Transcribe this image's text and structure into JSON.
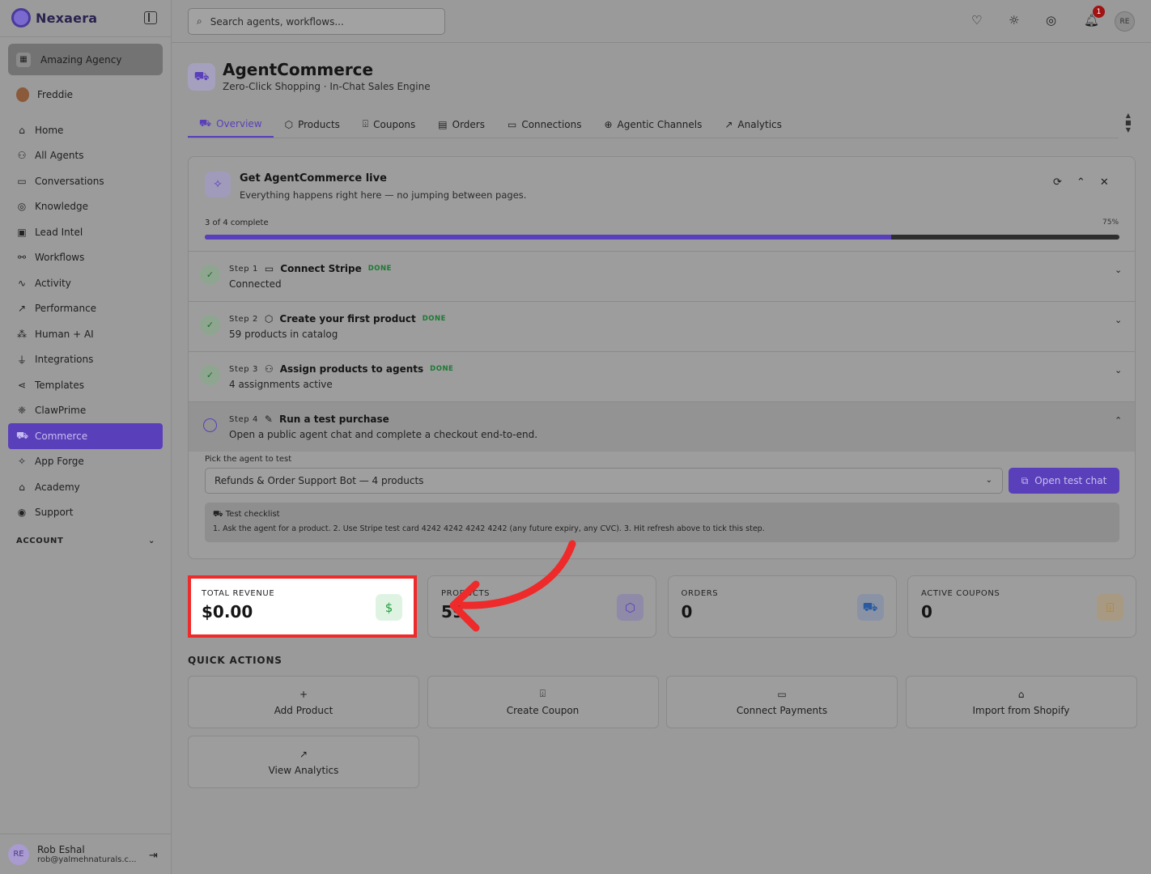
{
  "brand": {
    "name": "Nexaera"
  },
  "sidebar": {
    "agency": "Amazing Agency",
    "user": "Freddie",
    "items": [
      {
        "label": "Home",
        "icon": "home-icon",
        "glyph": "⌂"
      },
      {
        "label": "All Agents",
        "icon": "bot-icon",
        "glyph": "⚇"
      },
      {
        "label": "Conversations",
        "icon": "chat-icon",
        "glyph": "▭"
      },
      {
        "label": "Knowledge",
        "icon": "brain-icon",
        "glyph": "◎"
      },
      {
        "label": "Lead Intel",
        "icon": "contact-icon",
        "glyph": "▣"
      },
      {
        "label": "Workflows",
        "icon": "workflow-icon",
        "glyph": "⚯"
      },
      {
        "label": "Activity",
        "icon": "activity-icon",
        "glyph": "∿"
      },
      {
        "label": "Performance",
        "icon": "trend-icon",
        "glyph": "↗"
      },
      {
        "label": "Human + AI",
        "icon": "users-icon",
        "glyph": "⁂"
      },
      {
        "label": "Integrations",
        "icon": "plug-icon",
        "glyph": "⏚"
      },
      {
        "label": "Templates",
        "icon": "share-icon",
        "glyph": "⋖"
      },
      {
        "label": "ClawPrime",
        "icon": "paw-icon",
        "glyph": "❈"
      },
      {
        "label": "Commerce",
        "icon": "cart-icon",
        "glyph": "⛟"
      },
      {
        "label": "App Forge",
        "icon": "sparkles-icon",
        "glyph": "✧"
      },
      {
        "label": "Academy",
        "icon": "graduation-icon",
        "glyph": "⌂"
      },
      {
        "label": "Support",
        "icon": "lifebuoy-icon",
        "glyph": "◉"
      }
    ],
    "active_index": 12,
    "account_label": "ACCOUNT",
    "footer": {
      "initials": "RE",
      "name": "Rob Eshal",
      "email": "rob@yalmehnaturals.c..."
    }
  },
  "topbar": {
    "search_placeholder": "Search agents, workflows...",
    "notification_count": "1",
    "avatar_initials": "RE"
  },
  "page": {
    "title": "AgentCommerce",
    "subtitle": "Zero-Click Shopping · In-Chat Sales Engine",
    "tabs": [
      {
        "label": "Overview",
        "glyph": "⛟"
      },
      {
        "label": "Products",
        "glyph": "⬡"
      },
      {
        "label": "Coupons",
        "glyph": "⌹"
      },
      {
        "label": "Orders",
        "glyph": "▤"
      },
      {
        "label": "Connections",
        "glyph": "▭"
      },
      {
        "label": "Agentic Channels",
        "glyph": "⊕"
      },
      {
        "label": "Analytics",
        "glyph": "↗"
      }
    ]
  },
  "onboarding": {
    "title": "Get AgentCommerce live",
    "subtitle": "Everything happens right here — no jumping between pages.",
    "progress_label": "3 of 4 complete",
    "progress_percent_label": "75%",
    "progress_fraction": 0.75,
    "steps": [
      {
        "step": "Step 1",
        "title": "Connect Stripe",
        "status": "DONE",
        "desc": "Connected",
        "glyph": "▭"
      },
      {
        "step": "Step 2",
        "title": "Create your first product",
        "status": "DONE",
        "desc": "59 products in catalog",
        "glyph": "⬡"
      },
      {
        "step": "Step 3",
        "title": "Assign products to agents",
        "status": "DONE",
        "desc": "4 assignments active",
        "glyph": "⚇"
      },
      {
        "step": "Step 4",
        "title": "Run a test purchase",
        "status": "",
        "desc": "Open a public agent chat and complete a checkout end-to-end.",
        "glyph": "✎"
      }
    ],
    "pick_label": "Pick the agent to test",
    "selected_agent": "Refunds & Order Support Bot — 4 products",
    "open_button": "Open test chat",
    "checklist_title": "Test checklist",
    "checklist_body": "1. Ask the agent for a product. 2. Use Stripe test card 4242  4242  4242  4242 (any future expiry, any CVC). 3. Hit refresh above to tick this step."
  },
  "stats": [
    {
      "label": "TOTAL REVENUE",
      "value": "$0.00",
      "icon": "dollar-icon",
      "glyph": "$",
      "color": "#1e9e3a",
      "bg": "#dff3e3"
    },
    {
      "label": "PRODUCTS",
      "value": "59",
      "icon": "box-icon",
      "glyph": "⬡",
      "color": "#5a3fba",
      "bg": "#8f8aa8"
    },
    {
      "label": "ORDERS",
      "value": "0",
      "icon": "cart-icon",
      "glyph": "⛟",
      "color": "#2a5aa0",
      "bg": "#8a93a5"
    },
    {
      "label": "ACTIVE COUPONS",
      "value": "0",
      "icon": "ticket-icon",
      "glyph": "⌹",
      "color": "#b07a1a",
      "bg": "#a89a82"
    }
  ],
  "quick_actions": {
    "title": "QUICK ACTIONS",
    "items": [
      {
        "label": "Add Product",
        "glyph": "+"
      },
      {
        "label": "Create Coupon",
        "glyph": "⌹"
      },
      {
        "label": "Connect Payments",
        "glyph": "▭"
      },
      {
        "label": "Import from Shopify",
        "glyph": "⌂"
      },
      {
        "label": "View Analytics",
        "glyph": "↗"
      }
    ]
  }
}
